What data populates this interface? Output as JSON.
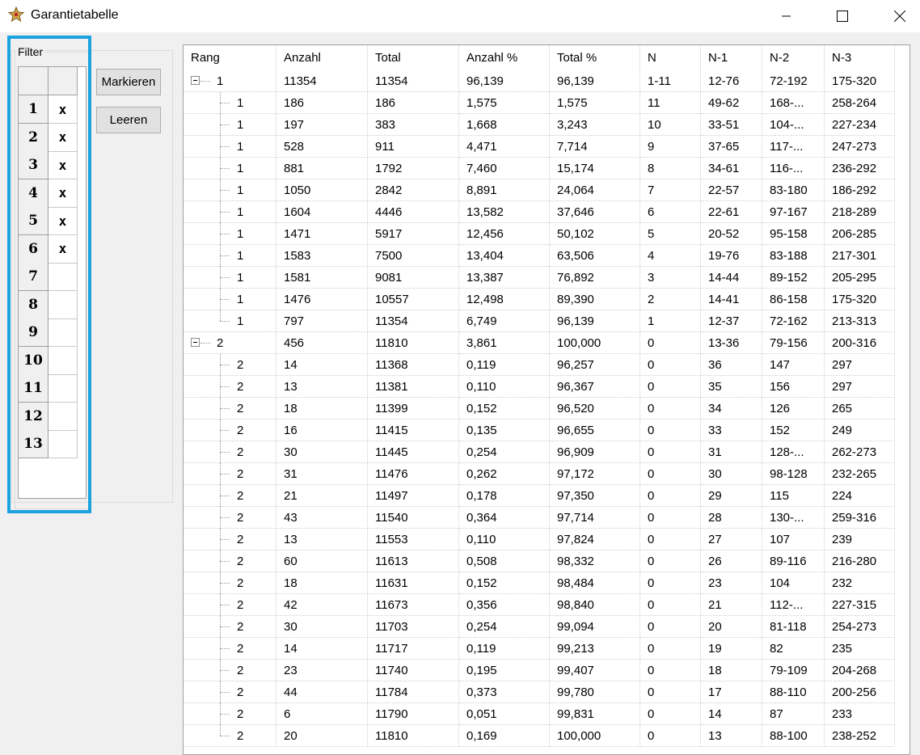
{
  "window": {
    "title": "Garantietabelle"
  },
  "filter": {
    "label": "Filter",
    "rows": [
      {
        "num": "1",
        "mark": "x"
      },
      {
        "num": "2",
        "mark": "x"
      },
      {
        "num": "3",
        "mark": "x"
      },
      {
        "num": "4",
        "mark": "x"
      },
      {
        "num": "5",
        "mark": "x"
      },
      {
        "num": "6",
        "mark": "x"
      },
      {
        "num": "7",
        "mark": ""
      },
      {
        "num": "8",
        "mark": ""
      },
      {
        "num": "9",
        "mark": ""
      },
      {
        "num": "10",
        "mark": ""
      },
      {
        "num": "11",
        "mark": ""
      },
      {
        "num": "12",
        "mark": ""
      },
      {
        "num": "13",
        "mark": ""
      }
    ]
  },
  "buttons": {
    "mark": "Markieren",
    "clear": "Leeren"
  },
  "table": {
    "columns": [
      "Rang",
      "Anzahl",
      "Total",
      "Anzahl %",
      "Total %",
      "N",
      "N-1",
      "N-2",
      "N-3"
    ],
    "rows": [
      {
        "level": 0,
        "cells": [
          "1",
          "11354",
          "11354",
          "96,139",
          "96,139",
          "1-11",
          "12-76",
          "72-192",
          "175-320"
        ]
      },
      {
        "level": 1,
        "cells": [
          "1",
          "186",
          "186",
          "1,575",
          "1,575",
          "11",
          "49-62",
          "168-...",
          "258-264"
        ]
      },
      {
        "level": 1,
        "cells": [
          "1",
          "197",
          "383",
          "1,668",
          "3,243",
          "10",
          "33-51",
          "104-...",
          "227-234"
        ]
      },
      {
        "level": 1,
        "cells": [
          "1",
          "528",
          "911",
          "4,471",
          "7,714",
          "9",
          "37-65",
          "117-...",
          "247-273"
        ]
      },
      {
        "level": 1,
        "cells": [
          "1",
          "881",
          "1792",
          "7,460",
          "15,174",
          "8",
          "34-61",
          "116-...",
          "236-292"
        ]
      },
      {
        "level": 1,
        "cells": [
          "1",
          "1050",
          "2842",
          "8,891",
          "24,064",
          "7",
          "22-57",
          "83-180",
          "186-292"
        ]
      },
      {
        "level": 1,
        "cells": [
          "1",
          "1604",
          "4446",
          "13,582",
          "37,646",
          "6",
          "22-61",
          "97-167",
          "218-289"
        ]
      },
      {
        "level": 1,
        "cells": [
          "1",
          "1471",
          "5917",
          "12,456",
          "50,102",
          "5",
          "20-52",
          "95-158",
          "206-285"
        ]
      },
      {
        "level": 1,
        "cells": [
          "1",
          "1583",
          "7500",
          "13,404",
          "63,506",
          "4",
          "19-76",
          "83-188",
          "217-301"
        ]
      },
      {
        "level": 1,
        "cells": [
          "1",
          "1581",
          "9081",
          "13,387",
          "76,892",
          "3",
          "14-44",
          "89-152",
          "205-295"
        ]
      },
      {
        "level": 1,
        "cells": [
          "1",
          "1476",
          "10557",
          "12,498",
          "89,390",
          "2",
          "14-41",
          "86-158",
          "175-320"
        ]
      },
      {
        "level": 1,
        "cells": [
          "1",
          "797",
          "11354",
          "6,749",
          "96,139",
          "1",
          "12-37",
          "72-162",
          "213-313"
        ]
      },
      {
        "level": 0,
        "cells": [
          "2",
          "456",
          "11810",
          "3,861",
          "100,000",
          "0",
          "13-36",
          "79-156",
          "200-316"
        ]
      },
      {
        "level": 1,
        "cells": [
          "2",
          "14",
          "11368",
          "0,119",
          "96,257",
          "0",
          "36",
          "147",
          "297"
        ]
      },
      {
        "level": 1,
        "cells": [
          "2",
          "13",
          "11381",
          "0,110",
          "96,367",
          "0",
          "35",
          "156",
          "297"
        ]
      },
      {
        "level": 1,
        "cells": [
          "2",
          "18",
          "11399",
          "0,152",
          "96,520",
          "0",
          "34",
          "126",
          "265"
        ]
      },
      {
        "level": 1,
        "cells": [
          "2",
          "16",
          "11415",
          "0,135",
          "96,655",
          "0",
          "33",
          "152",
          "249"
        ]
      },
      {
        "level": 1,
        "cells": [
          "2",
          "30",
          "11445",
          "0,254",
          "96,909",
          "0",
          "31",
          "128-...",
          "262-273"
        ]
      },
      {
        "level": 1,
        "cells": [
          "2",
          "31",
          "11476",
          "0,262",
          "97,172",
          "0",
          "30",
          "98-128",
          "232-265"
        ]
      },
      {
        "level": 1,
        "cells": [
          "2",
          "21",
          "11497",
          "0,178",
          "97,350",
          "0",
          "29",
          "115",
          "224"
        ]
      },
      {
        "level": 1,
        "cells": [
          "2",
          "43",
          "11540",
          "0,364",
          "97,714",
          "0",
          "28",
          "130-...",
          "259-316"
        ]
      },
      {
        "level": 1,
        "cells": [
          "2",
          "13",
          "11553",
          "0,110",
          "97,824",
          "0",
          "27",
          "107",
          "239"
        ]
      },
      {
        "level": 1,
        "cells": [
          "2",
          "60",
          "11613",
          "0,508",
          "98,332",
          "0",
          "26",
          "89-116",
          "216-280"
        ]
      },
      {
        "level": 1,
        "cells": [
          "2",
          "18",
          "11631",
          "0,152",
          "98,484",
          "0",
          "23",
          "104",
          "232"
        ]
      },
      {
        "level": 1,
        "cells": [
          "2",
          "42",
          "11673",
          "0,356",
          "98,840",
          "0",
          "21",
          "112-...",
          "227-315"
        ]
      },
      {
        "level": 1,
        "cells": [
          "2",
          "30",
          "11703",
          "0,254",
          "99,094",
          "0",
          "20",
          "81-118",
          "254-273"
        ]
      },
      {
        "level": 1,
        "cells": [
          "2",
          "14",
          "11717",
          "0,119",
          "99,213",
          "0",
          "19",
          "82",
          "235"
        ]
      },
      {
        "level": 1,
        "cells": [
          "2",
          "23",
          "11740",
          "0,195",
          "99,407",
          "0",
          "18",
          "79-109",
          "204-268"
        ]
      },
      {
        "level": 1,
        "cells": [
          "2",
          "44",
          "11784",
          "0,373",
          "99,780",
          "0",
          "17",
          "88-110",
          "200-256"
        ]
      },
      {
        "level": 1,
        "cells": [
          "2",
          "6",
          "11790",
          "0,051",
          "99,831",
          "0",
          "14",
          "87",
          "233"
        ]
      },
      {
        "level": 1,
        "cells": [
          "2",
          "20",
          "11810",
          "0,169",
          "100,000",
          "0",
          "13",
          "88-100",
          "238-252"
        ]
      }
    ]
  },
  "colors": {
    "highlight": "#1ba3e0"
  }
}
